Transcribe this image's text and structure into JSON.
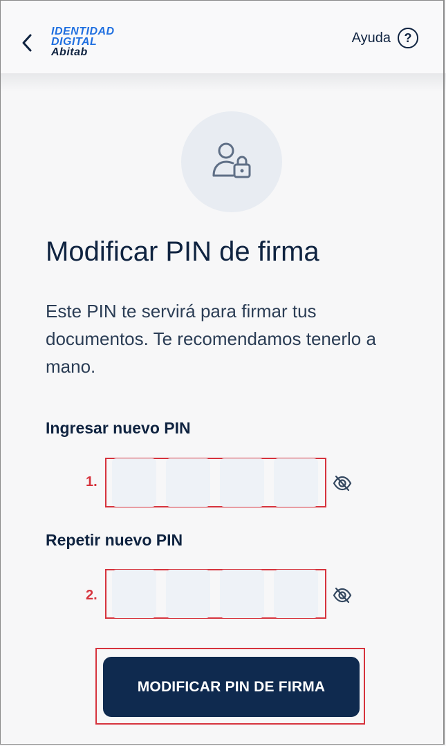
{
  "header": {
    "logo_line1": "IDENTIDAD",
    "logo_line2": "DIGITAL",
    "logo_line3": "Abitab",
    "help_label": "Ayuda",
    "help_icon": "?"
  },
  "main": {
    "icon": "user-lock-icon",
    "title": "Modificar PIN de firma",
    "description": "Este PIN te servirá para firmar tus documentos. Te recomendamos tenerlo a mano.",
    "new_pin_label": "Ingresar nuevo PIN",
    "repeat_pin_label": "Repetir nuevo PIN",
    "marker_1": "1.",
    "marker_2": "2.",
    "submit_label": "MODIFICAR PIN DE FIRMA"
  },
  "colors": {
    "brand_dark": "#0f2a4f",
    "brand_blue": "#1f6fe0",
    "annotation_red": "#d6333d"
  }
}
